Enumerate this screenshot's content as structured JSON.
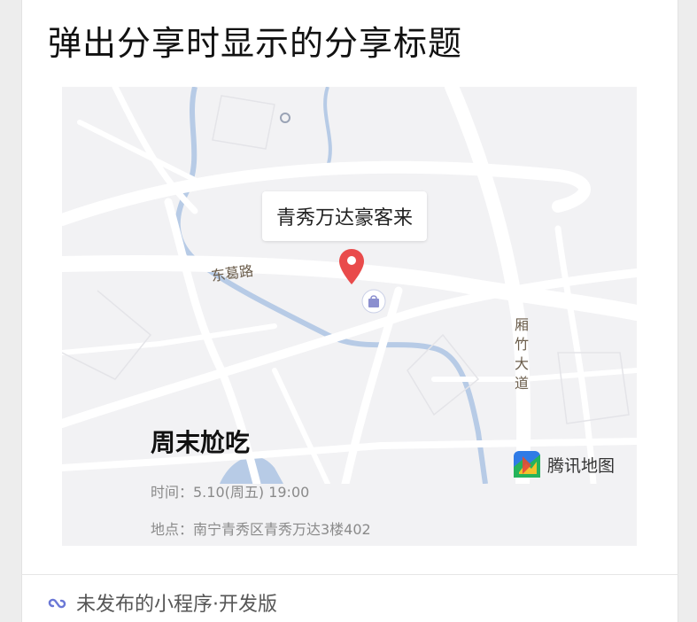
{
  "share": {
    "title": "弹出分享时显示的分享标题"
  },
  "map": {
    "place_name": "青秀万达豪客来",
    "road_east": "东葛路",
    "road_vertical": "厢竹大道",
    "provider": "腾讯地图",
    "pin_icon": "location-pin-icon",
    "poi_icon": "shopping-bag-icon"
  },
  "event": {
    "name": "周末尬吃",
    "time": "时间：5.10(周五) 19:00",
    "location": "地点：南宁青秀区青秀万达3楼402"
  },
  "footer": {
    "status": "未发布的小程序·开发版",
    "icon": "miniprogram-icon"
  },
  "colors": {
    "pin": "#e94b4b",
    "water": "#b7cbe6",
    "road": "#ffffff",
    "map_bg": "#f2f2f4"
  }
}
